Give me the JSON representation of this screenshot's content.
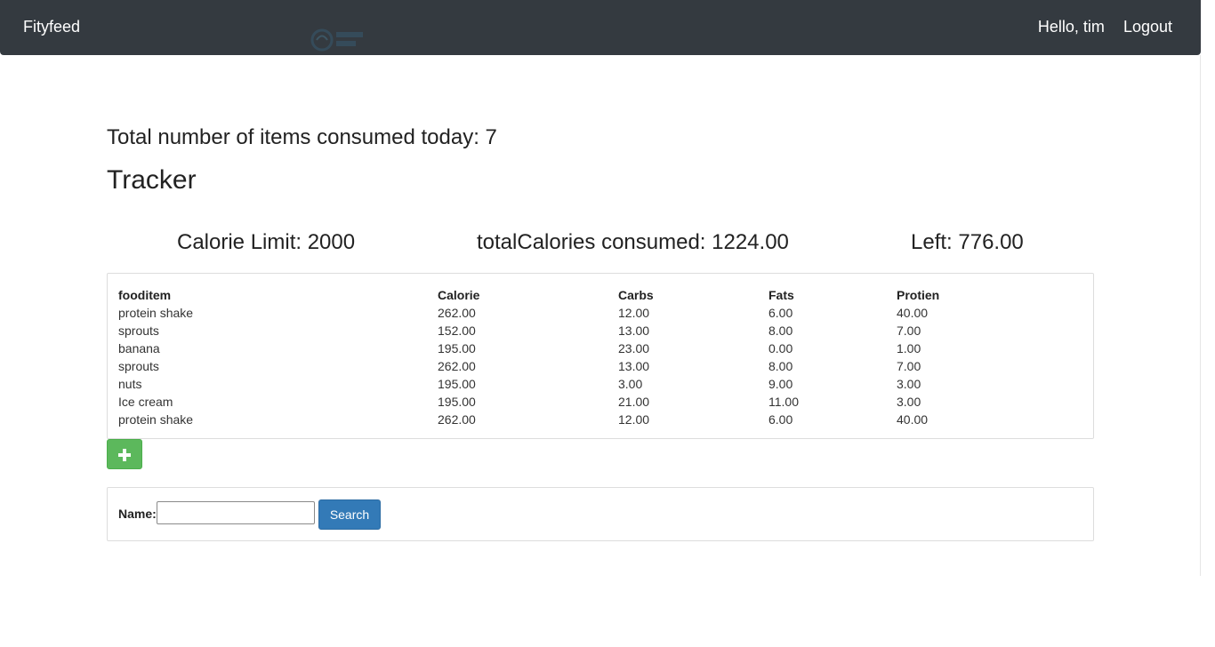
{
  "navbar": {
    "brand": "Fityfeed",
    "greeting": "Hello, tim",
    "logout_label": "Logout"
  },
  "summary": {
    "total_items_text": "Total number of items consumed today: 7",
    "tracker_title": "Tracker",
    "calorie_limit_text": "Calorie Limit: 2000",
    "total_calories_text": "totalCalories consumed: 1224.00",
    "left_text": "Left: 776.00"
  },
  "food_table": {
    "headers": [
      "fooditem",
      "Calorie",
      "Carbs",
      "Fats",
      "Protien"
    ],
    "rows": [
      [
        "protein shake",
        "262.00",
        "12.00",
        "6.00",
        "40.00"
      ],
      [
        "sprouts",
        "152.00",
        "13.00",
        "8.00",
        "7.00"
      ],
      [
        "banana",
        "195.00",
        "23.00",
        "0.00",
        "1.00"
      ],
      [
        "sprouts",
        "262.00",
        "13.00",
        "8.00",
        "7.00"
      ],
      [
        "nuts",
        "195.00",
        "3.00",
        "9.00",
        "3.00"
      ],
      [
        "Ice cream",
        "195.00",
        "21.00",
        "11.00",
        "3.00"
      ],
      [
        "protein shake",
        "262.00",
        "12.00",
        "6.00",
        "40.00"
      ]
    ]
  },
  "add_button": {
    "icon": "plus-icon",
    "color": "#5cb85c"
  },
  "search": {
    "label": "Name:",
    "value": "",
    "button_label": "Search",
    "button_color": "#337ab7"
  },
  "colors": {
    "navbar_bg": "#343a40"
  }
}
